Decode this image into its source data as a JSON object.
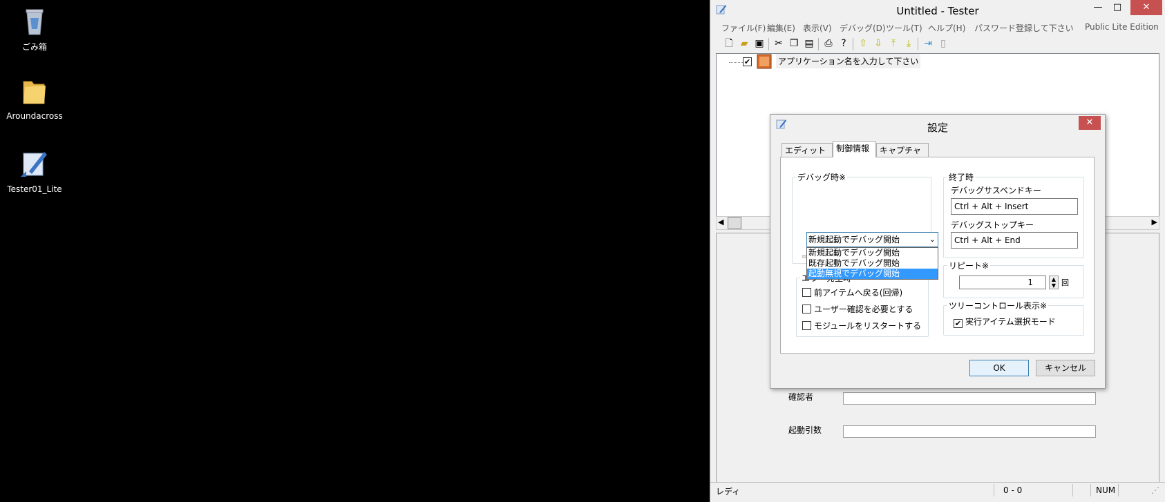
{
  "desktop": {
    "icons": [
      {
        "label": "ごみ箱"
      },
      {
        "label": "Aroundacross"
      },
      {
        "label": "Tester01_Lite"
      }
    ]
  },
  "window": {
    "title": "Untitled - Tester",
    "min_glyph": "—",
    "max_glyph": "□",
    "close_glyph": "✕",
    "menu": [
      "ファイル(F)",
      "編集(E)",
      "表示(V)",
      "デバッグ(D)",
      "ツール(T)",
      "ヘルプ(H)",
      "パスワード登録して下さい"
    ],
    "edition": "Public Lite Edition",
    "tree": {
      "root_label": "アプリケーション名を入力して下さい",
      "checked": true
    },
    "fields": [
      {
        "label": "確認者",
        "value": ""
      },
      {
        "label": "起動引数",
        "value": ""
      }
    ],
    "status": {
      "left": "レディ",
      "position": "0 -    0",
      "num": "NUM"
    }
  },
  "dialog": {
    "title": "設定",
    "close_glyph": "✕",
    "tabs": [
      "エディット情報",
      "制御情報",
      "キャプチャ情報"
    ],
    "active_tab": 1,
    "debug_group": {
      "title": "デバッグ時※",
      "combo_value": "新規起動でデバッグ開始",
      "options": [
        "新規起動でデバッグ開始",
        "既存起動でデバッグ開始",
        "起動無視でデバッグ開始"
      ],
      "highlighted_option": 2,
      "slider_level": 1.0
    },
    "error_group": {
      "title": "エラー発生時",
      "checks": [
        {
          "label": "前アイテムへ戻る(回帰)",
          "checked": false
        },
        {
          "label": "ユーザー確認を必要とする",
          "checked": false
        },
        {
          "label": "モジュールをリスタートする",
          "checked": false
        }
      ]
    },
    "end_group": {
      "title": "終了時",
      "suspend_label": "デバッグサスペンドキー",
      "suspend_value": "Ctrl + Alt + Insert",
      "stop_label": "デバッグストップキー",
      "stop_value": "Ctrl + Alt + End"
    },
    "repeat_group": {
      "title": "リピート※",
      "value": "1",
      "unit": "回"
    },
    "tree_group": {
      "title": "ツリーコントロール表示※",
      "check_label": "実行アイテム選択モード",
      "checked": true
    },
    "ok_label": "OK",
    "cancel_label": "キャンセル"
  }
}
